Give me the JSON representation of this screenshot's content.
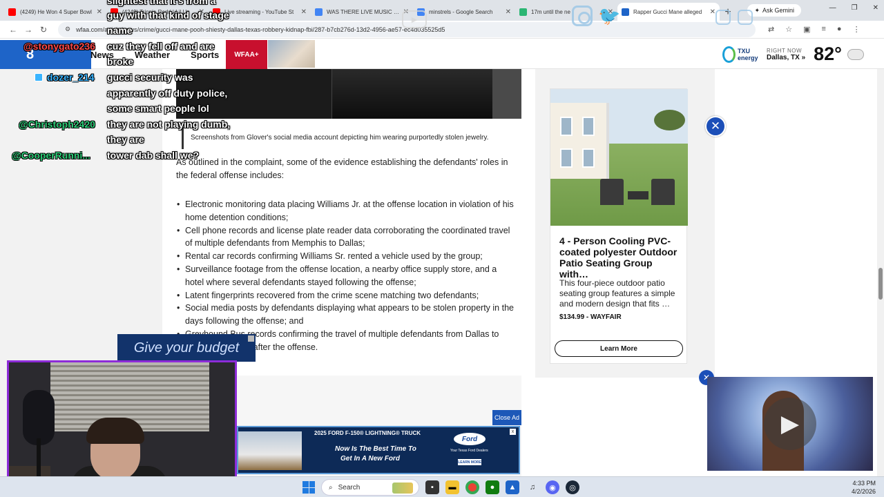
{
  "browser": {
    "tabs": [
      {
        "title": "(4249) He Won 4 Super Bowl",
        "favicon_color": "#ff0000",
        "active": false
      },
      {
        "title": "(4249) Trippie Redd | Lil Uz",
        "favicon_color": "#ff0000",
        "active": false
      },
      {
        "title": "Live streaming - YouTube St",
        "favicon_color": "#ff0000",
        "active": false
      },
      {
        "title": "WAS THERE LIVE MUSIC IN T",
        "favicon_color": "#4285f4",
        "active": false
      },
      {
        "title": "minstrels - Google Search",
        "favicon_color": "#4285f4",
        "active": false
      },
      {
        "title": "17m until the ne",
        "favicon_color": "#2bb673",
        "active": false
      },
      {
        "title": "Rapper Gucci Mane alleged",
        "favicon_color": "#1e64c8",
        "active": true
      }
    ],
    "new_tab": "+",
    "gemini": "Ask Gemini",
    "window_controls": [
      "—",
      "❐",
      "✕"
    ],
    "url": "wfaa.com/article/news/crime/gucci-mane-pooh-shiesty-dallas-texas-robbery-kidnap-fbi/287-b7cb276d-13d2-4956-ae57-ec4d035525d5",
    "nav_back": "←",
    "nav_forward": "→",
    "nav_reload": "↻"
  },
  "site": {
    "nav": [
      "News",
      "Weather",
      "Sports"
    ],
    "wfaa_plus": "WFAA+",
    "weather": {
      "label": "RIGHT NOW",
      "city": "Dallas, TX »",
      "temp": "82°",
      "sponsor": "TXU energy"
    }
  },
  "article": {
    "caption": "Screenshots from Glover's social media account depicting him wearing purportedly stolen jewelry.",
    "intro": "As outlined in the complaint, some of the evidence establishing the defendants' roles in the federal offense includes:",
    "bullets": [
      "Electronic monitoring data placing Williams Jr. at the offense location in violation of his home detention conditions;",
      "Cell phone records and license plate reader data corroborating the coordinated travel of multiple defendants from Memphis to Dallas;",
      "Rental car records confirming Williams Sr. rented a vehicle used by the group;",
      "Surveillance footage from the offense location, a nearby office supply store, and a hotel where several defendants stayed following the offense;",
      "Latent fingerprints recovered from the crime scene matching two defendants;",
      "Social media posts by defendants displaying what appears to be stolen property in the days following the offense; and",
      "Greyhound Bus records confirming the travel of multiple defendants from Dallas to Memphis the day after the offense."
    ],
    "inline_ad_text": "Give your budget"
  },
  "sidebar_ad": {
    "title": "4 - Person Cooling PVC-coated polyester Outdoor Patio Seating Group with…",
    "description": "This four-piece outdoor patio seating group features a simple and modern design that fits …",
    "price": "$134.99 - WAYFAIR",
    "button": "Learn More"
  },
  "bottom_ad": {
    "close": "Close Ad",
    "headline": "2025 FORD F-150® LIGHTNING® TRUCK",
    "line1": "Now Is The Best Time To",
    "line2": "Get In A New Ford",
    "brand": "Ford",
    "dealers": "Your Texas Ford Dealers",
    "learn": "LEARN MORE",
    "close_x": "x"
  },
  "video": {
    "play": "▶"
  },
  "close_icon": "✕",
  "chat": {
    "lines": [
      {
        "name": "",
        "text": "slightest that it's from a",
        "color": "#ffffff"
      },
      {
        "name": "",
        "text": "guy with that kind of stage",
        "color": "#ffffff"
      },
      {
        "name": "",
        "text": "name",
        "color": "#ffffff"
      },
      {
        "name": "@stonygato236",
        "text": "cuz they fell off and are",
        "color": "#ff4a4a"
      },
      {
        "name": "",
        "text": "broke",
        "color": "#ffffff"
      },
      {
        "name": "dozer_214",
        "text": "gucci security was",
        "color": "#3ab4ff"
      },
      {
        "name": "",
        "text": "apparently off duty police,",
        "color": "#ffffff"
      },
      {
        "name": "",
        "text": "some smart people lol",
        "color": "#ffffff"
      },
      {
        "name": "@Christoph2420",
        "text": "they are not playing dumb,",
        "color": "#2ed07a"
      },
      {
        "name": "",
        "text": "they are",
        "color": "#ffffff"
      },
      {
        "name": "@CooperRunni...",
        "text": "tower dab shall we?",
        "color": "#2ed07a"
      }
    ]
  },
  "taskbar": {
    "search": "Search",
    "time": "4:33 PM",
    "date": "4/2/2026"
  }
}
